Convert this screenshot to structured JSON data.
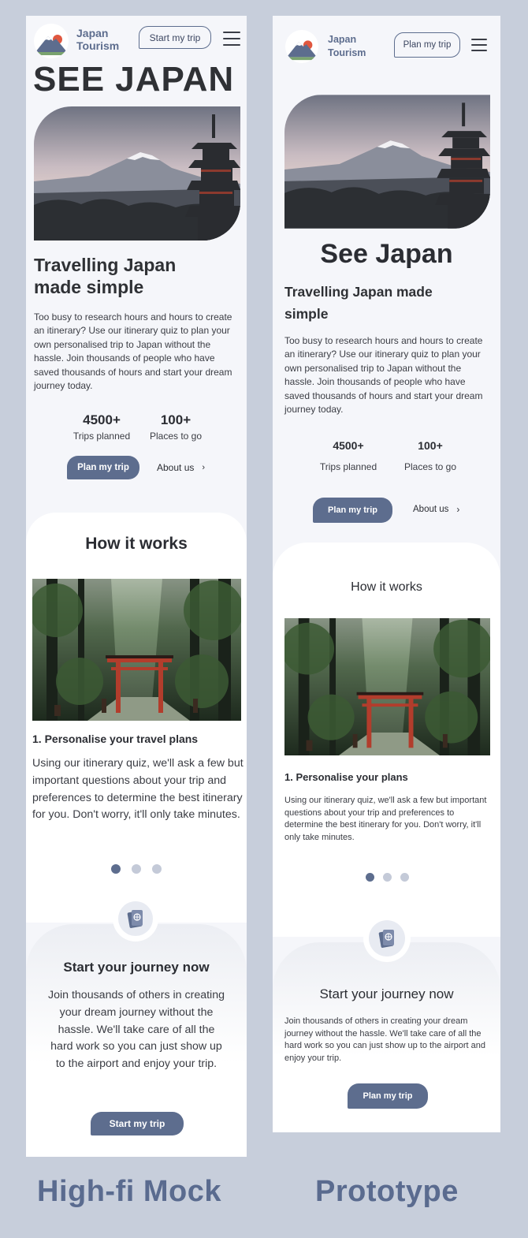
{
  "colors": {
    "background": "#c7cedb",
    "screen": "#f5f6fa",
    "accent": "#5d6d8e",
    "text": "#2b2d33"
  },
  "mock": {
    "brand_line1": "Japan",
    "brand_line2": "Tourism",
    "header_button": "Start my trip",
    "hero_headline": "SEE JAPAN",
    "subheading_line1": "Travelling Japan",
    "subheading_line2": "made simple",
    "intro": "Too busy to research hours and hours to create an itinerary? Use our itinerary quiz to plan your own personalised trip to Japan without the hassle. Join thousands of people who have saved thousands of hours and start your dream journey today.",
    "stats": [
      {
        "value": "4500+",
        "label": "Trips planned"
      },
      {
        "value": "100+",
        "label": "Places to go"
      }
    ],
    "primary_cta": "Plan my trip",
    "secondary_cta": "About us",
    "how_title": "How it works",
    "step_title": "1. Personalise your travel plans",
    "step_text": "Using our itinerary quiz, we'll ask a few but important questions about your trip and preferences to determine the best itinerary for you. Don't worry, it'll only take minutes.",
    "carousel": {
      "total": 3,
      "active": 1
    },
    "journey_title": "Start your journey now",
    "journey_text": "Join thousands of others in creating your dream journey without the hassle. We'll take care of all the hard work so you can just show up to the airport and enjoy your trip.",
    "journey_cta": "Start my trip"
  },
  "proto": {
    "brand_line1": "Japan",
    "brand_line2": "Tourism",
    "header_button": "Plan my trip",
    "hero_headline": "See Japan",
    "subheading_line1": "Travelling Japan made",
    "subheading_line2": "simple",
    "intro": "Too busy to research hours and hours to create an itinerary? Use our itinerary quiz to plan your own personalised trip to Japan without the hassle. Join thousands of people who have saved thousands of hours and start your dream journey today.",
    "stats": [
      {
        "value": "4500+",
        "label": "Trips planned"
      },
      {
        "value": "100+",
        "label": "Places to go"
      }
    ],
    "primary_cta": "Plan my trip",
    "secondary_cta": "About us",
    "how_title": "How it works",
    "step_title": "1. Personalise your plans",
    "step_text": "Using our itinerary quiz, we'll ask a few but important questions about your trip and preferences to determine the best itinerary for you. Don't worry, it'll only take minutes.",
    "carousel": {
      "total": 3,
      "active": 1
    },
    "journey_title": "Start your journey now",
    "journey_text": "Join thousands of others in creating your dream journey without the hassle. We'll take care of all the hard work so you can just show up to the airport and enjoy your trip.",
    "journey_cta": "Plan my trip"
  },
  "captions": {
    "left": "High-fi Mock",
    "right": "Prototype"
  },
  "icons": {
    "menu": "hamburger-menu-icon",
    "chevron": "chevron-right-icon",
    "logo": "mount-fuji-logo-icon",
    "passport": "passport-icon"
  }
}
